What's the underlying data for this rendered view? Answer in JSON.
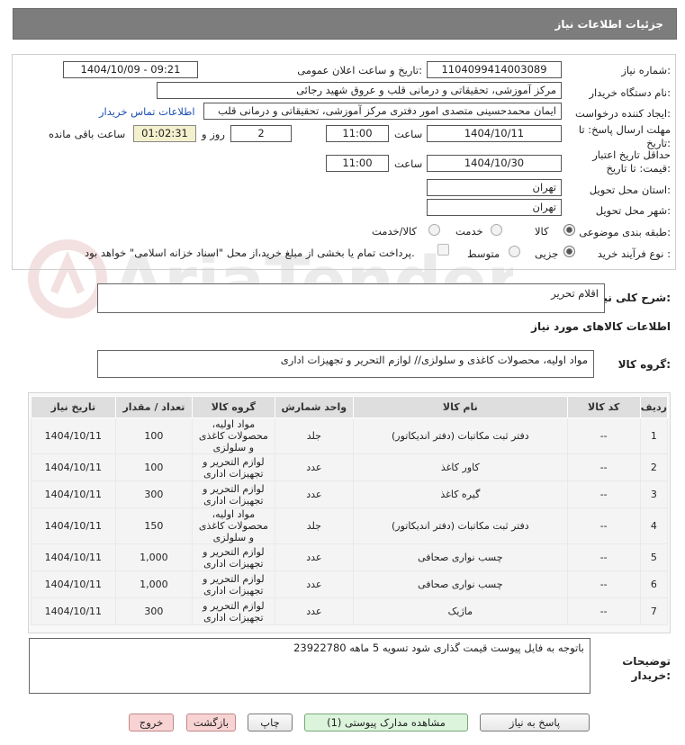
{
  "header": {
    "title": "جزئیات اطلاعات نیاز"
  },
  "form": {
    "need_number_label": "شماره نیاز:",
    "need_number": "1104099414003089",
    "announce_label": "تاریخ و ساعت اعلان عمومی:",
    "announce_value": "1404/10/09 - 09:21",
    "buyer_label": "نام دستگاه خریدار:",
    "buyer_value": "مرکز آموزشی، تحقیقاتی و درمانی قلب و عروق شهید رجائی",
    "creator_label": "ایجاد کننده درخواست:",
    "creator_value": "ایمان محمدحسینی متصدی امور دفتری مرکز آموزشی، تحقیقاتی و درمانی قلب",
    "contact_link": "اطلاعات تماس خریدار",
    "deadline_label": "مهلت ارسال پاسخ: تا تاریخ:",
    "deadline_date": "1404/10/11",
    "time_label": "ساعت",
    "deadline_time": "11:00",
    "days_value": "2",
    "days_label": "روز و",
    "remaining_time": "01:02:31",
    "remaining_label": "ساعت باقی مانده",
    "validity_label": "حداقل تاریخ اعتبار قیمت: تا تاریخ:",
    "validity_date": "1404/10/30",
    "validity_time": "11:00",
    "province_label": "استان محل تحویل:",
    "province_value": "تهران",
    "city_label": "شهر محل تحویل:",
    "city_value": "تهران",
    "category_label": "طبقه بندی موضوعی:",
    "category_options": [
      "کالا",
      "خدمت",
      "کالا/خدمت"
    ],
    "category_selected": "کالا",
    "process_label": "نوع فرآیند خرید :",
    "process_options": [
      "جزیی",
      "متوسط"
    ],
    "process_selected": "جزیی",
    "payment_note": "پرداخت تمام یا بخشی از مبلغ خرید،از محل \"اسناد خزانه اسلامی\" خواهد بود."
  },
  "summary": {
    "label": "شرح کلی نیاز:",
    "value": "اقلام تحریر"
  },
  "goods_info": {
    "title": "اطلاعات کالاهای مورد نیاز",
    "group_label": "گروه کالا:",
    "group_value": "مواد اولیه، محصولات کاغذی و سلولزی// لوازم التحریر و تجهیزات اداری"
  },
  "table": {
    "headers": [
      "ردیف",
      "کد کالا",
      "نام کالا",
      "واحد شمارش",
      "گروه کالا",
      "تعداد / مقدار",
      "تاریخ نیاز"
    ],
    "rows": [
      [
        "1",
        "--",
        "دفتر ثبت مکاتبات (دفتر اندیکاتور)",
        "جلد",
        "مواد اولیه، محصولات کاغذی و سلولزی",
        "100",
        "1404/10/11"
      ],
      [
        "2",
        "--",
        "کاور کاغذ",
        "عدد",
        "لوازم التحریر و تجهیزات اداری",
        "100",
        "1404/10/11"
      ],
      [
        "3",
        "--",
        "گیره کاغذ",
        "عدد",
        "لوازم التحریر و تجهیزات اداری",
        "300",
        "1404/10/11"
      ],
      [
        "4",
        "--",
        "دفتر ثبت مکاتبات (دفتر اندیکاتور)",
        "جلد",
        "مواد اولیه، محصولات کاغذی و سلولزی",
        "150",
        "1404/10/11"
      ],
      [
        "5",
        "--",
        "چسب نواری صحافی",
        "عدد",
        "لوازم التحریر و تجهیزات اداری",
        "1,000",
        "1404/10/11"
      ],
      [
        "6",
        "--",
        "چسب نواری صحافی",
        "عدد",
        "لوازم التحریر و تجهیزات اداری",
        "1,000",
        "1404/10/11"
      ],
      [
        "7",
        "--",
        "ماژیک",
        "عدد",
        "لوازم التحریر و تجهیزات اداری",
        "300",
        "1404/10/11"
      ]
    ]
  },
  "notes": {
    "label": "توضیحات خریدار:",
    "value": "باتوجه به فایل پیوست قیمت گذاری شود تسویه 5 ماهه 23922780"
  },
  "buttons": {
    "reply": "پاسخ به نیاز",
    "docs": "مشاهده مدارک پیوستی (1)",
    "print": "چاپ",
    "back": "بازگشت",
    "exit": "خروج"
  },
  "watermark": {
    "text": "AriaTender.net"
  }
}
